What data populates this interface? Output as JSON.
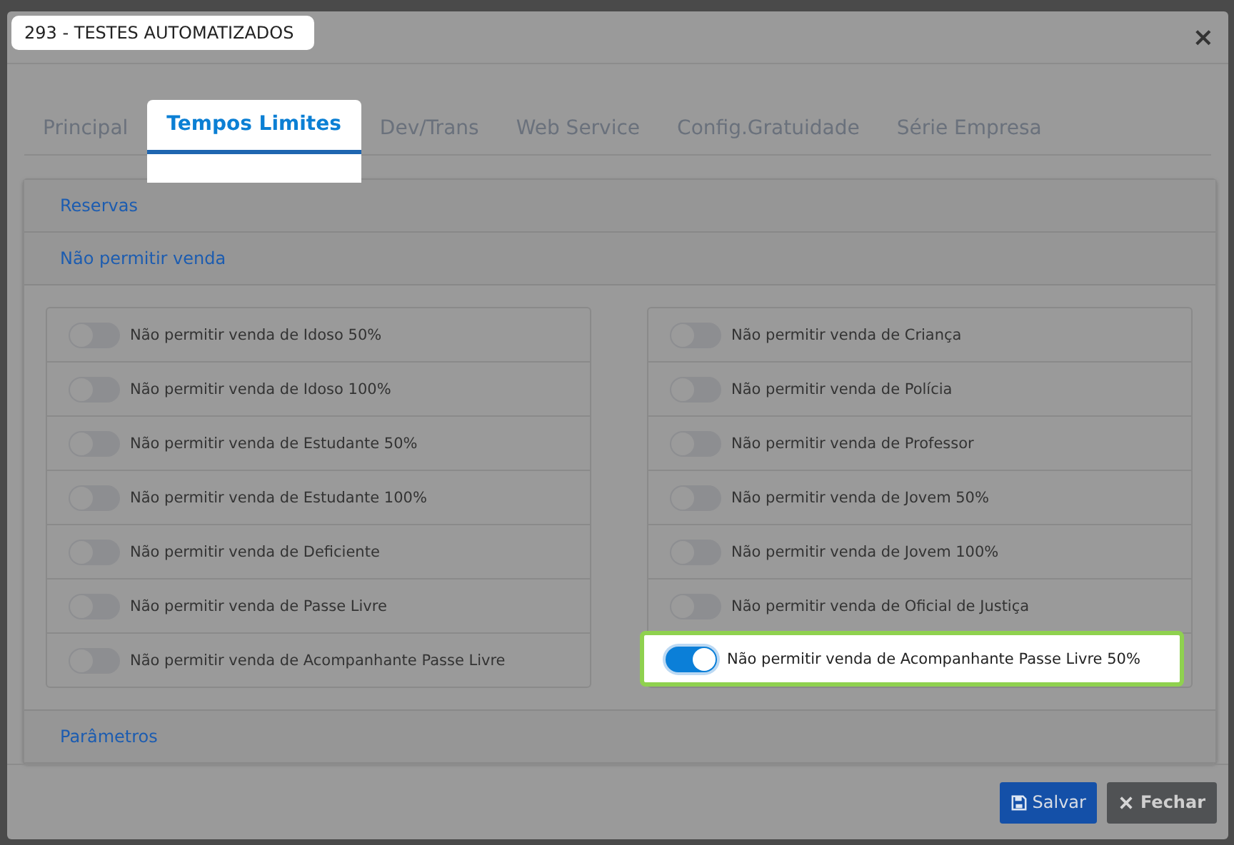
{
  "dialog": {
    "title": {
      "text": "293 - TESTES AUTOMATIZADOS",
      "spotlight": true
    },
    "close": "×"
  },
  "tabs": [
    {
      "label": "Principal",
      "selected": false,
      "spotlight": false
    },
    {
      "label": "Tempos Limites",
      "selected": true,
      "spotlight": true
    },
    {
      "label": "Dev/Trans",
      "selected": false,
      "spotlight": false
    },
    {
      "label": "Web Service",
      "selected": false,
      "spotlight": false
    },
    {
      "label": "Config.Gratuidade",
      "selected": false,
      "spotlight": false
    },
    {
      "label": "Série Empresa",
      "selected": false,
      "spotlight": false
    }
  ],
  "sections": [
    {
      "title": "Reservas"
    },
    {
      "title": "Não permitir venda",
      "columns": [
        [
          {
            "label": "Não permitir venda de Idoso 50%",
            "on": false,
            "spotlight": false
          },
          {
            "label": "Não permitir venda de Idoso 100%",
            "on": false,
            "spotlight": false
          },
          {
            "label": "Não permitir venda de Estudante 50%",
            "on": false,
            "spotlight": false
          },
          {
            "label": "Não permitir venda de Estudante 100%",
            "on": false,
            "spotlight": false
          },
          {
            "label": "Não permitir venda de Deficiente",
            "on": false,
            "spotlight": false
          },
          {
            "label": "Não permitir venda de Passe Livre",
            "on": false,
            "spotlight": false
          },
          {
            "label": "Não permitir venda de Acompanhante Passe Livre",
            "on": false,
            "spotlight": false
          }
        ],
        [
          {
            "label": "Não permitir venda de Criança",
            "on": false,
            "spotlight": false
          },
          {
            "label": "Não permitir venda de Polícia",
            "on": false,
            "spotlight": false
          },
          {
            "label": "Não permitir venda de Professor",
            "on": false,
            "spotlight": false
          },
          {
            "label": "Não permitir venda de Jovem 50%",
            "on": false,
            "spotlight": false
          },
          {
            "label": "Não permitir venda de Jovem 100%",
            "on": false,
            "spotlight": false
          },
          {
            "label": "Não permitir venda de Oficial de Justiça",
            "on": false,
            "spotlight": false
          },
          {
            "label": "Não permitir venda de Acompanhante Passe Livre 50%",
            "on": true,
            "spotlight": true
          }
        ]
      ]
    },
    {
      "title": "Parâmetros"
    }
  ],
  "buttons": [
    {
      "kind": "save",
      "label": "Salvar"
    },
    {
      "kind": "close",
      "label": "Fechar"
    }
  ]
}
